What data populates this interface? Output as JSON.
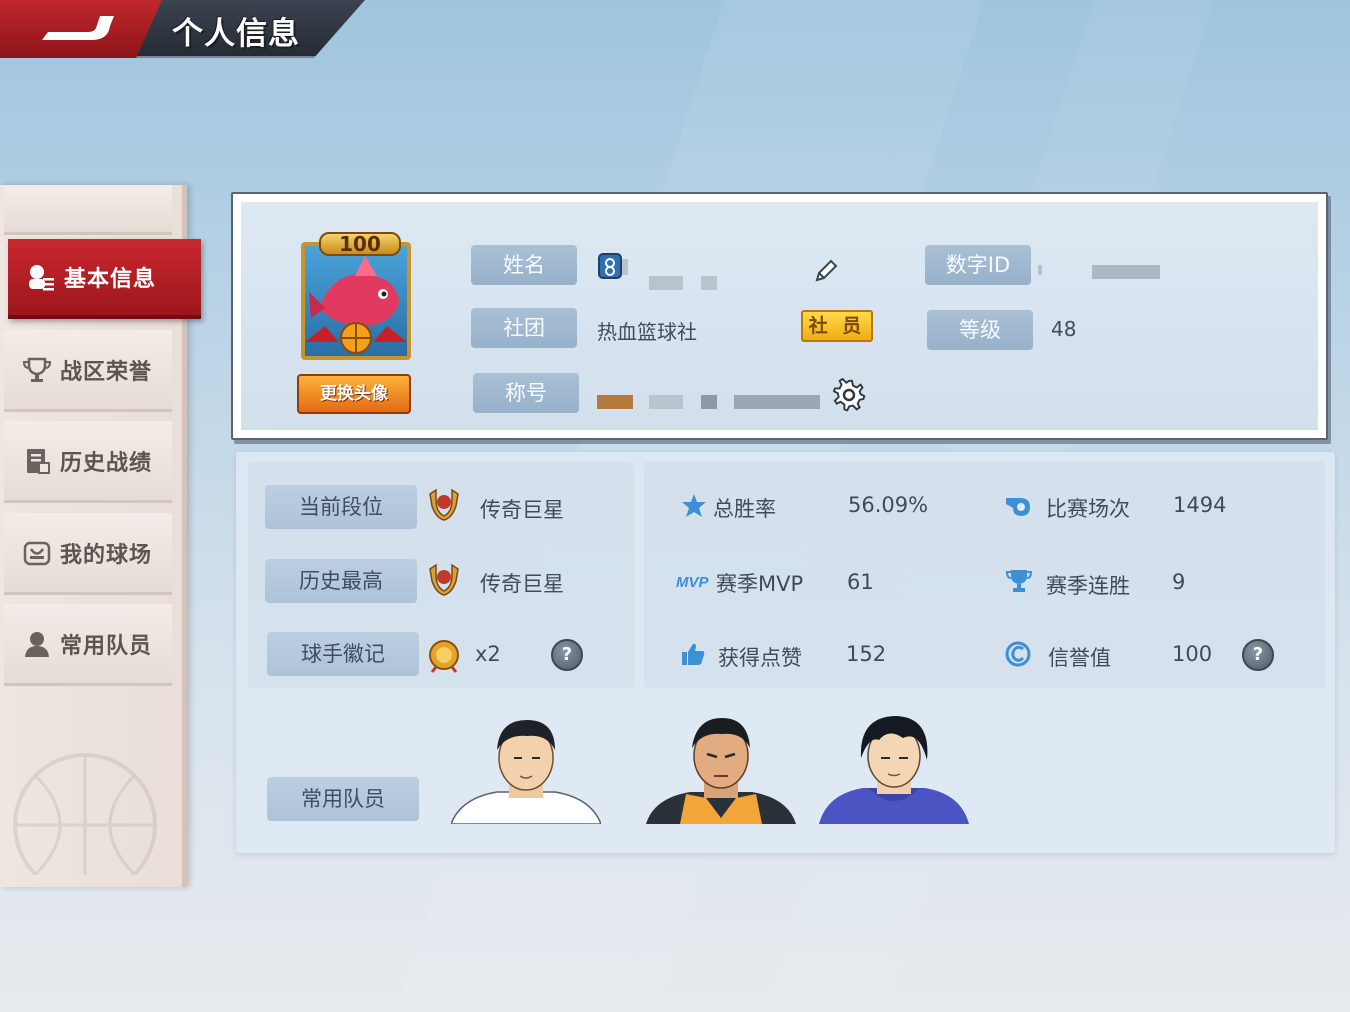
{
  "header": {
    "title": "个人信息"
  },
  "sidebar": {
    "items": [
      {
        "label": "基本信息",
        "icon": "profile-card-icon",
        "active": true
      },
      {
        "label": "战区荣誉",
        "icon": "trophy-icon",
        "active": false
      },
      {
        "label": "历史战绩",
        "icon": "record-document-icon",
        "active": false
      },
      {
        "label": "我的球场",
        "icon": "court-icon",
        "active": false
      },
      {
        "label": "常用队员",
        "icon": "player-silhouette-icon",
        "active": false
      }
    ]
  },
  "profile": {
    "avatar_level": "100",
    "change_avatar_label": "更换头像",
    "name_label": "姓名",
    "id_label": "数字ID",
    "club_label": "社团",
    "club_value": "热血篮球社",
    "club_role": "社 员",
    "level_label": "等级",
    "level_value": "48",
    "title_label": "称号"
  },
  "stats": {
    "current_rank_label": "当前段位",
    "current_rank_value": "传奇巨星",
    "highest_rank_label": "历史最高",
    "highest_rank_value": "传奇巨星",
    "badge_label": "球手徽记",
    "badge_value": "x2",
    "win_rate_label": "总胜率",
    "win_rate_value": "56.09%",
    "matches_label": "比赛场次",
    "matches_value": "1494",
    "mvp_label": "赛季MVP",
    "mvp_value": "61",
    "streak_label": "赛季连胜",
    "streak_value": "9",
    "likes_label": "获得点赞",
    "likes_value": "152",
    "credit_label": "信誉值",
    "credit_value": "100",
    "frequent_players_label": "常用队员",
    "help_glyph": "?"
  },
  "colors": {
    "accent_red": "#c1272d",
    "member_gold": "#f0ad12",
    "change_avatar_orange": "#e26a14"
  }
}
